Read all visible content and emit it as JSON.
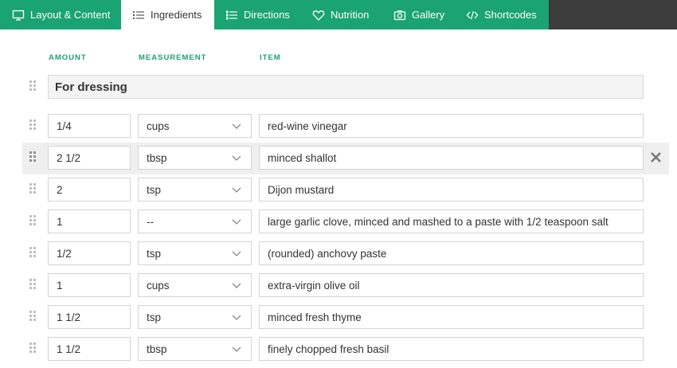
{
  "tabs": [
    {
      "label": "Layout & Content",
      "icon": "monitor-icon",
      "active": false
    },
    {
      "label": "Ingredients",
      "icon": "list-icon",
      "active": true
    },
    {
      "label": "Directions",
      "icon": "numbered-list-icon",
      "active": false
    },
    {
      "label": "Nutrition",
      "icon": "heart-icon",
      "active": false
    },
    {
      "label": "Gallery",
      "icon": "camera-icon",
      "active": false
    },
    {
      "label": "Shortcodes",
      "icon": "code-icon",
      "active": false
    }
  ],
  "columns": {
    "amount": "AMOUNT",
    "measurement": "MEASUREMENT",
    "item": "ITEM"
  },
  "group": {
    "title": "For dressing"
  },
  "ingredients": [
    {
      "amount": "1/4",
      "unit": "cups",
      "item": "red-wine vinegar"
    },
    {
      "amount": "2 1/2",
      "unit": "tbsp",
      "item": "minced shallot"
    },
    {
      "amount": "2",
      "unit": "tsp",
      "item": "Dijon mustard"
    },
    {
      "amount": "1",
      "unit": "--",
      "item": "large garlic clove, minced and mashed to a paste with 1/2 teaspoon salt"
    },
    {
      "amount": "1/2",
      "unit": "tsp",
      "item": "(rounded) anchovy paste"
    },
    {
      "amount": "1",
      "unit": "cups",
      "item": "extra-virgin olive oil"
    },
    {
      "amount": "1 1/2",
      "unit": "tsp",
      "item": "minced fresh thyme"
    },
    {
      "amount": "1 1/2",
      "unit": "tbsp",
      "item": "finely chopped fresh basil"
    }
  ],
  "colors": {
    "accent": "#1aa373",
    "tabbar_bg": "#3c3c3c",
    "hover_row": "#efefef"
  }
}
